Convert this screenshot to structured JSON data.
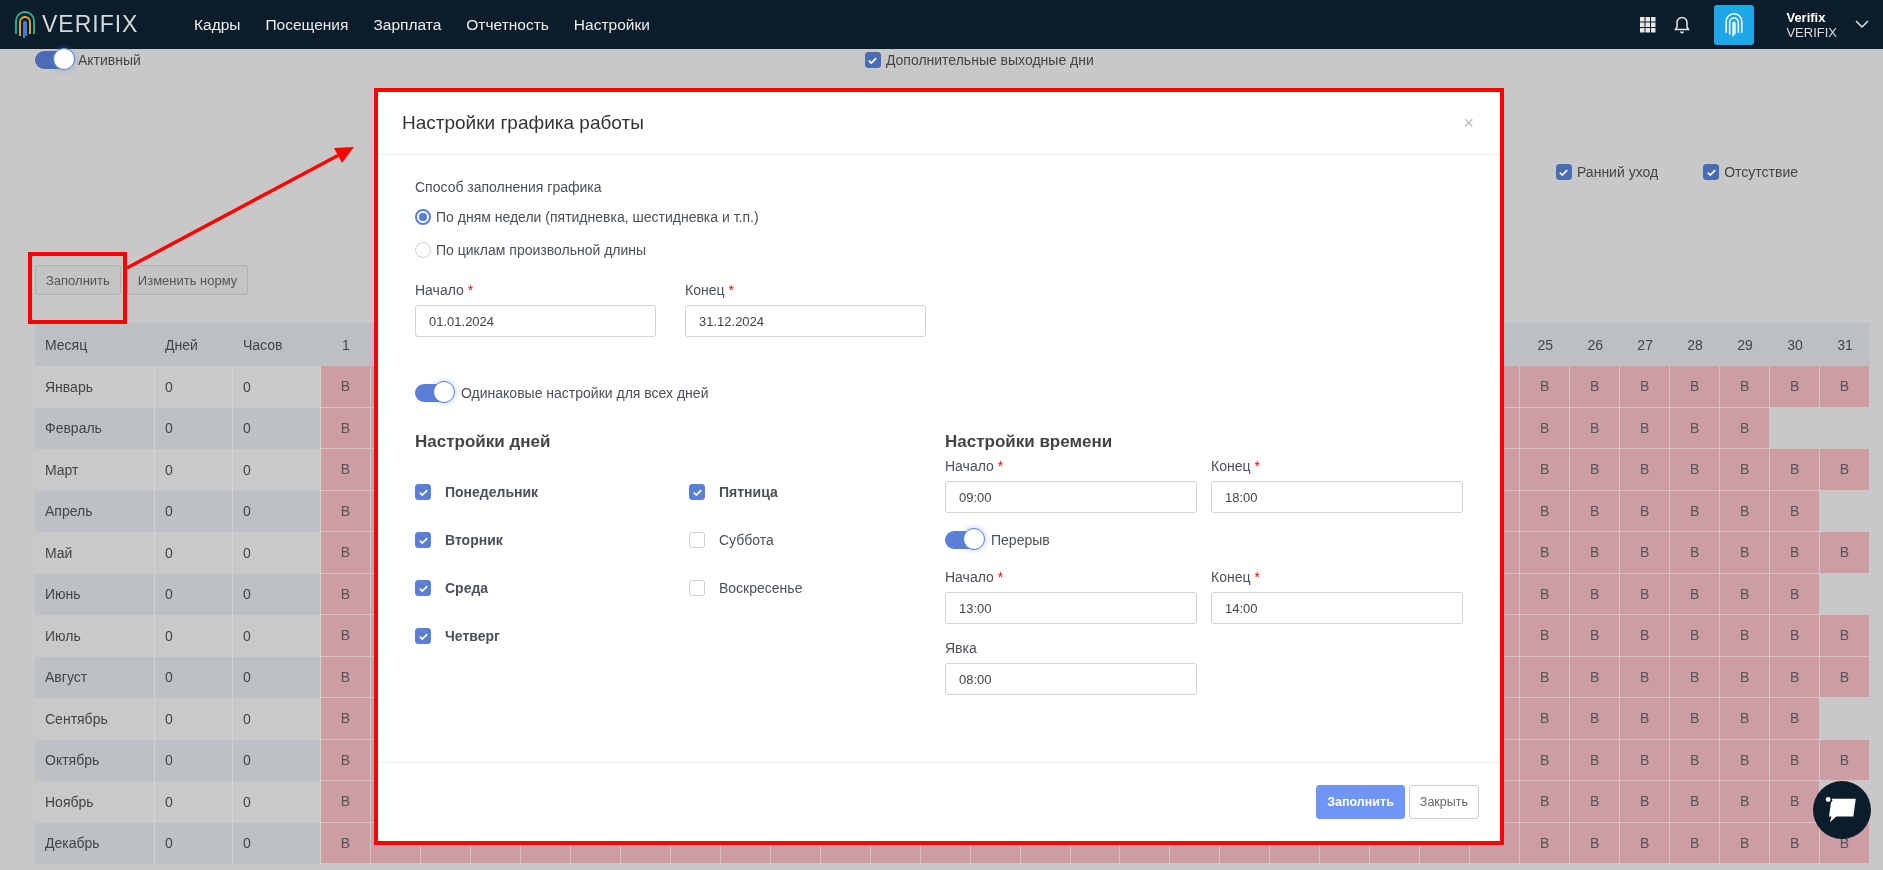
{
  "top_nav": {
    "logo": "VERIFIX",
    "menu": [
      {
        "label": "Кадры"
      },
      {
        "label": "Посещения"
      },
      {
        "label": "Зарплата"
      },
      {
        "label": "Отчетность"
      },
      {
        "label": "Настройки"
      }
    ],
    "user": {
      "name": "Verifix",
      "company": "VERIFIX"
    }
  },
  "page": {
    "active_toggle": {
      "label": "Активный",
      "on": true
    },
    "extra_days": {
      "label": "Дополнительные выходные дни",
      "checked": true
    },
    "filters": [
      {
        "label": "Ранний уход",
        "checked": true
      },
      {
        "label": "Отсутствие",
        "checked": true
      }
    ],
    "buttons": [
      {
        "label": "Заполнить"
      },
      {
        "label": "Изменить норму"
      }
    ],
    "table": {
      "columns": [
        "Месяц",
        "Дней",
        "Часов"
      ],
      "day_columns": [
        "1",
        "25",
        "26",
        "27",
        "28",
        "29",
        "30",
        "31"
      ],
      "rows": [
        {
          "month": "Январь",
          "days": "0",
          "hours": "0",
          "cells": [
            "В",
            "В",
            "В",
            "В",
            "В",
            "В",
            "В",
            "В"
          ]
        },
        {
          "month": "Февраль",
          "days": "0",
          "hours": "0",
          "cells": [
            "В",
            "В",
            "В",
            "В",
            "В",
            "В",
            null,
            null
          ]
        },
        {
          "month": "Март",
          "days": "0",
          "hours": "0",
          "cells": [
            "В",
            "В",
            "В",
            "В",
            "В",
            "В",
            "В",
            "В"
          ]
        },
        {
          "month": "Апрель",
          "days": "0",
          "hours": "0",
          "cells": [
            "В",
            "В",
            "В",
            "В",
            "В",
            "В",
            "В",
            null
          ]
        },
        {
          "month": "Май",
          "days": "0",
          "hours": "0",
          "cells": [
            "В",
            "В",
            "В",
            "В",
            "В",
            "В",
            "В",
            "В"
          ]
        },
        {
          "month": "Июнь",
          "days": "0",
          "hours": "0",
          "cells": [
            "В",
            "В",
            "В",
            "В",
            "В",
            "В",
            "В",
            null
          ]
        },
        {
          "month": "Июль",
          "days": "0",
          "hours": "0",
          "cells": [
            "В",
            "В",
            "В",
            "В",
            "В",
            "В",
            "В",
            "В"
          ]
        },
        {
          "month": "Август",
          "days": "0",
          "hours": "0",
          "cells": [
            "В",
            "В",
            "В",
            "В",
            "В",
            "В",
            "В",
            "В"
          ]
        },
        {
          "month": "Сентябрь",
          "days": "0",
          "hours": "0",
          "cells": [
            "В",
            "В",
            "В",
            "В",
            "В",
            "В",
            "В",
            null
          ]
        },
        {
          "month": "Октябрь",
          "days": "0",
          "hours": "0",
          "cells": [
            "В",
            "В",
            "В",
            "В",
            "В",
            "В",
            "В",
            "В"
          ]
        },
        {
          "month": "Ноябрь",
          "days": "0",
          "hours": "0",
          "cells": [
            "В",
            "В",
            "В",
            "В",
            "В",
            "В",
            "В",
            null
          ]
        },
        {
          "month": "Декабрь",
          "days": "0",
          "hours": "0",
          "cells": [
            "В",
            "В",
            "В",
            "В",
            "В",
            "В",
            "В",
            "В"
          ]
        }
      ]
    }
  },
  "dialog": {
    "title": "Настройки графика работы",
    "close": "×",
    "fill_method": {
      "label": "Способ заполнения графика",
      "options": [
        {
          "label": "По дням недели (пятидневка, шестидневка и т.п.)",
          "selected": true
        },
        {
          "label": "По циклам произвольной длины",
          "selected": false
        }
      ]
    },
    "period": [
      {
        "label": "Начало",
        "required_mark": "*",
        "value": "01.01.2024"
      },
      {
        "label": "Конец",
        "required_mark": "*",
        "value": "31.12.2024"
      }
    ],
    "same_settings": {
      "label": "Одинаковые настройки для всех дней",
      "on": true
    },
    "day_settings": {
      "title": "Настройки дней",
      "days": [
        {
          "label": "Понедельник",
          "checked": true
        },
        {
          "label": "Вторник",
          "checked": true
        },
        {
          "label": "Среда",
          "checked": true
        },
        {
          "label": "Четверг",
          "checked": true
        },
        {
          "label": "Пятница",
          "checked": true
        },
        {
          "label": "Суббота",
          "checked": false
        },
        {
          "label": "Воскресенье",
          "checked": false
        }
      ]
    },
    "time_settings": {
      "title": "Настройки времени",
      "work": [
        {
          "label": "Начало",
          "required_mark": "*",
          "value": "09:00"
        },
        {
          "label": "Конец",
          "required_mark": "*",
          "value": "18:00"
        }
      ],
      "break_toggle": {
        "label": "Перерыв",
        "on": true
      },
      "break": [
        {
          "label": "Начало",
          "required_mark": "*",
          "value": "13:00"
        },
        {
          "label": "Конец",
          "required_mark": "*",
          "value": "14:00"
        }
      ],
      "attendance": [
        {
          "label": "Явка",
          "value": "08:00"
        }
      ]
    },
    "buttons": [
      {
        "label": "Заполнить",
        "kind": "primary"
      },
      {
        "label": "Закрыть",
        "kind": "secondary"
      }
    ]
  }
}
